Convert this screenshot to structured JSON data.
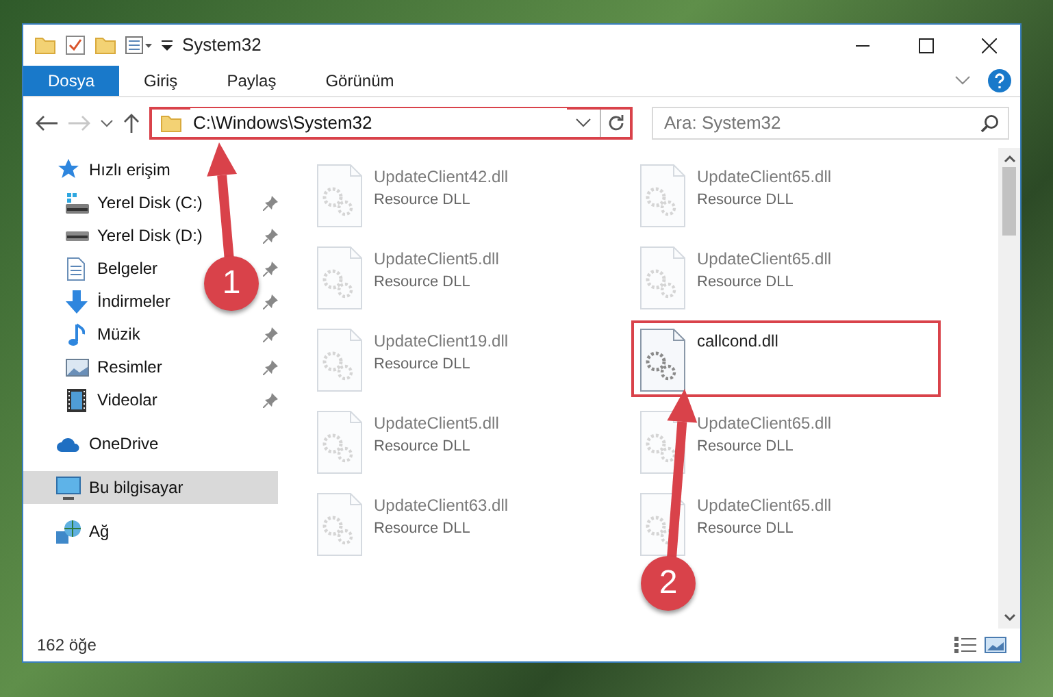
{
  "window": {
    "title": "System32"
  },
  "ribbon_tabs": [
    {
      "label": "Dosya",
      "selected": true
    },
    {
      "label": "Giriş",
      "selected": false
    },
    {
      "label": "Paylaş",
      "selected": false
    },
    {
      "label": "Görünüm",
      "selected": false
    }
  ],
  "address": {
    "path": "C:\\Windows\\System32",
    "highlighted": true
  },
  "search": {
    "placeholder": "Ara: System32"
  },
  "sidebar": {
    "items": [
      {
        "label": "Hızlı erişim",
        "kind": "star",
        "selected": false,
        "children": [
          {
            "label": "Yerel Disk (C:)",
            "kind": "drive-system",
            "pinned": true,
            "selected": false
          },
          {
            "label": "Yerel Disk (D:)",
            "kind": "drive",
            "pinned": true,
            "selected": false
          },
          {
            "label": "Belgeler",
            "kind": "document",
            "pinned": true,
            "selected": false
          },
          {
            "label": "İndirmeler",
            "kind": "download",
            "pinned": true,
            "selected": false
          },
          {
            "label": "Müzik",
            "kind": "music",
            "pinned": true,
            "selected": false
          },
          {
            "label": "Resimler",
            "kind": "picture",
            "pinned": true,
            "selected": false
          },
          {
            "label": "Videolar",
            "kind": "video",
            "pinned": true,
            "selected": false
          }
        ]
      },
      {
        "label": "OneDrive",
        "kind": "cloud",
        "selected": false
      },
      {
        "label": "Bu bilgisayar",
        "kind": "computer",
        "selected": true
      },
      {
        "label": "Ağ",
        "kind": "network",
        "selected": false
      }
    ]
  },
  "files": [
    {
      "name": "UpdateClient42.dll",
      "type": "Resource DLL",
      "faded": true,
      "highlighted": false
    },
    {
      "name": "UpdateClient65.dll",
      "type": "Resource DLL",
      "faded": true,
      "highlighted": false
    },
    {
      "name": "UpdateClient5.dll",
      "type": "Resource DLL",
      "faded": true,
      "highlighted": false
    },
    {
      "name": "UpdateClient65.dll",
      "type": "Resource DLL",
      "faded": true,
      "highlighted": false
    },
    {
      "name": "UpdateClient19.dll",
      "type": "Resource DLL",
      "faded": true,
      "highlighted": false
    },
    {
      "name": "callcond.dll",
      "faded": false,
      "highlighted": true
    },
    {
      "name": "UpdateClient5.dll",
      "type": "Resource DLL",
      "faded": true,
      "highlighted": false
    },
    {
      "name": "UpdateClient65.dll",
      "type": "Resource DLL",
      "faded": true,
      "highlighted": false
    },
    {
      "name": "UpdateClient63.dll",
      "type": "Resource DLL",
      "faded": true,
      "highlighted": false
    },
    {
      "name": "UpdateClient65.dll",
      "type": "Resource DLL",
      "faded": true,
      "highlighted": false
    }
  ],
  "callouts": [
    {
      "number": "1"
    },
    {
      "number": "2"
    }
  ],
  "status_bar": {
    "count": "162 öğe"
  }
}
